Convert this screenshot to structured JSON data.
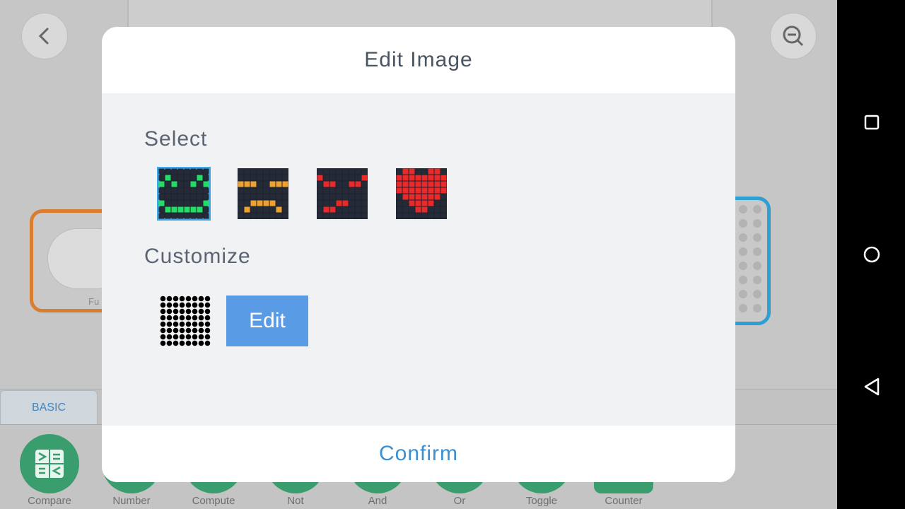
{
  "background": {
    "orange_block_label": "Fu",
    "tabs": [
      {
        "label": "BASIC"
      }
    ],
    "palette": [
      {
        "label": "Compare"
      },
      {
        "label": "Number"
      },
      {
        "label": "Compute"
      },
      {
        "label": "Not"
      },
      {
        "label": "And"
      },
      {
        "label": "Or"
      },
      {
        "label": "Toggle"
      },
      {
        "label": "Counter"
      }
    ]
  },
  "dialog": {
    "title": "Edit Image",
    "select_label": "Select",
    "customize_label": "Customize",
    "edit_button": "Edit",
    "confirm_button": "Confirm",
    "presets": [
      {
        "name": "smile",
        "color": "#22dd66",
        "selected": true
      },
      {
        "name": "neutral",
        "color": "#f0a030",
        "selected": false
      },
      {
        "name": "angry",
        "color": "#e82a2a",
        "selected": false
      },
      {
        "name": "heart",
        "color": "#e82a2a",
        "selected": false
      }
    ]
  },
  "colors": {
    "accent": "#3ea8e8",
    "edit_button": "#5a9be6",
    "palette_green": "#3a9d6e",
    "block_orange": "#d97d2e",
    "block_blue": "#2d9fd0"
  },
  "icons": {
    "back": "chevron-left-icon",
    "zoom_out": "zoom-out-icon",
    "nav_recent": "square-icon",
    "nav_home": "circle-icon",
    "nav_back": "triangle-left-icon"
  }
}
